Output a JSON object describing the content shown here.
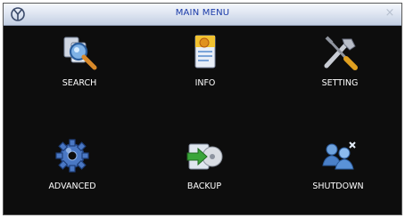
{
  "window": {
    "title": "MAIN MENU",
    "close_glyph": "×"
  },
  "menu": {
    "items": [
      {
        "label": "SEARCH",
        "icon": "search-icon"
      },
      {
        "label": "INFO",
        "icon": "info-icon"
      },
      {
        "label": "SETTING",
        "icon": "setting-icon"
      },
      {
        "label": "ADVANCED",
        "icon": "advanced-icon"
      },
      {
        "label": "BACKUP",
        "icon": "backup-icon"
      },
      {
        "label": "SHUTDOWN",
        "icon": "shutdown-icon"
      }
    ]
  },
  "colors": {
    "background": "#0d0d0d",
    "title_text": "#1a3aa8",
    "label_text": "#ffffff"
  }
}
